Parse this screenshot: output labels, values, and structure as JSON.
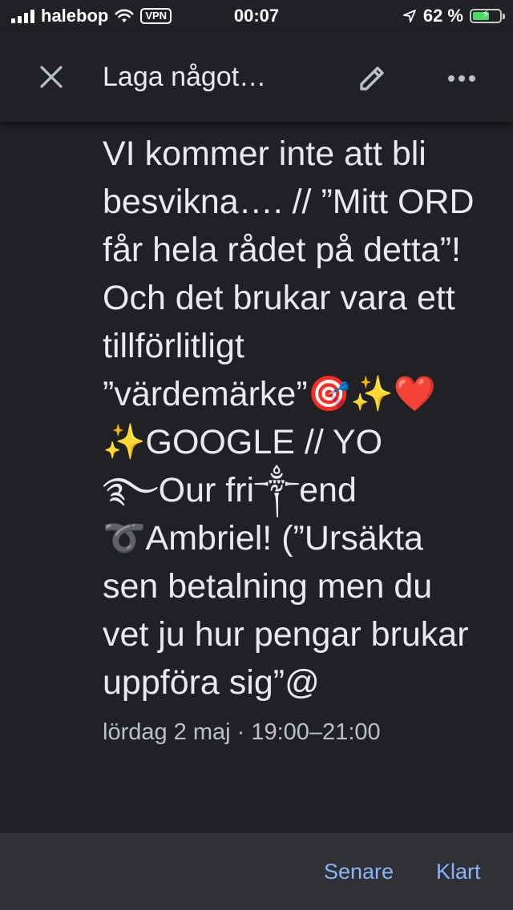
{
  "status_bar": {
    "carrier": "halebop",
    "vpn": "VPN",
    "time": "00:07",
    "battery_percent": "62 %",
    "battery_level": 0.62,
    "signal_bars": 4,
    "icons": [
      "signal-icon",
      "wifi-icon",
      "location-arrow-icon",
      "battery-charging-icon"
    ]
  },
  "app_bar": {
    "title": "Laga något…",
    "icons": [
      "close-icon",
      "edit-pencil-icon",
      "more-horizontal-icon"
    ]
  },
  "event": {
    "text": "VI kommer inte att bli besvikna…. // ”Mitt ORD får hela rådet på detta”! Och det brukar vara ett tillförlitligt ”värdemärke”🎯✨❤️✨GOOGLE // YO࿐Our fri༒end ➰Ambriel! (”Ursäkta sen betalning men du vet ju hur pengar brukar uppföra sig”@",
    "date": "lördag 2 maj · 19:00–21:00"
  },
  "bottom_bar": {
    "later_label": "Senare",
    "done_label": "Klart"
  },
  "colors": {
    "background": "#202124",
    "bottom_bar": "#303134",
    "accent": "#8ab4f8",
    "text": "#e8eaed",
    "secondary_text": "#bdc1c6",
    "battery_fill": "#4cd964"
  }
}
